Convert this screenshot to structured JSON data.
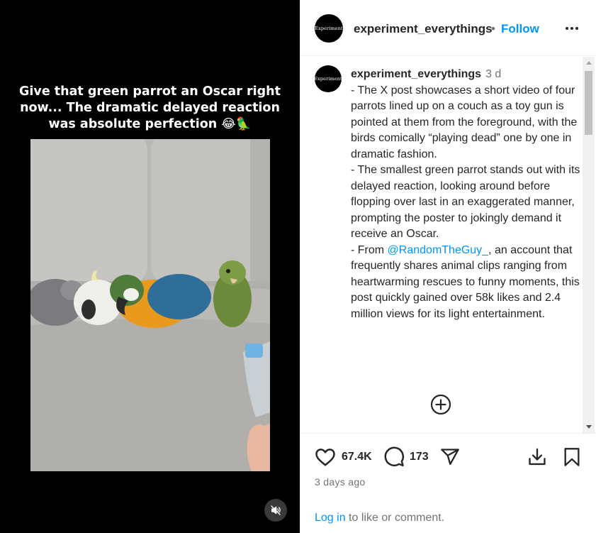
{
  "media": {
    "caption_line1": "Give that green parrot an Oscar right",
    "caption_line2": "now... The dramatic delayed reaction",
    "caption_line3": "was absolute perfection 😂🦜",
    "mute_icon": "speaker-muted-icon"
  },
  "header": {
    "avatar_text": "Experiment",
    "username": "experiment_everythings",
    "separator": "•",
    "follow_label": "Follow",
    "more_icon": "more-horizontal-icon"
  },
  "comment": {
    "avatar_text": "Experiment",
    "username": "experiment_everythings",
    "time": "3 d",
    "para1": "- The X post showcases a short video of four parrots lined up on a couch as a toy gun is pointed at them from the foreground, with the birds comically “playing dead” one by one in dramatic fashion.",
    "para2": "- The smallest green parrot stands out with its delayed reaction, looking around before flopping over last in an exaggerated manner, prompting the poster to jokingly demand it receive an Oscar.",
    "para3_prefix": "- From ",
    "para3_mention": "@RandomTheGuy_",
    "para3_suffix": ", an account that frequently shares animal clips ranging from heartwarming rescues to funny moments, this post quickly gained over 58k likes and 2.4 million views for its light entertainment.",
    "add_icon": "plus-circle-icon"
  },
  "actions": {
    "likes": "67.4K",
    "comments": "173",
    "icons": [
      "heart-icon",
      "comment-icon",
      "share-icon",
      "download-icon",
      "bookmark-icon"
    ],
    "posted": "3 days ago",
    "login_link": "Log in",
    "login_rest": " to like or comment."
  },
  "colors": {
    "link": "#0095f6",
    "text": "#262626",
    "muted": "#737373"
  }
}
